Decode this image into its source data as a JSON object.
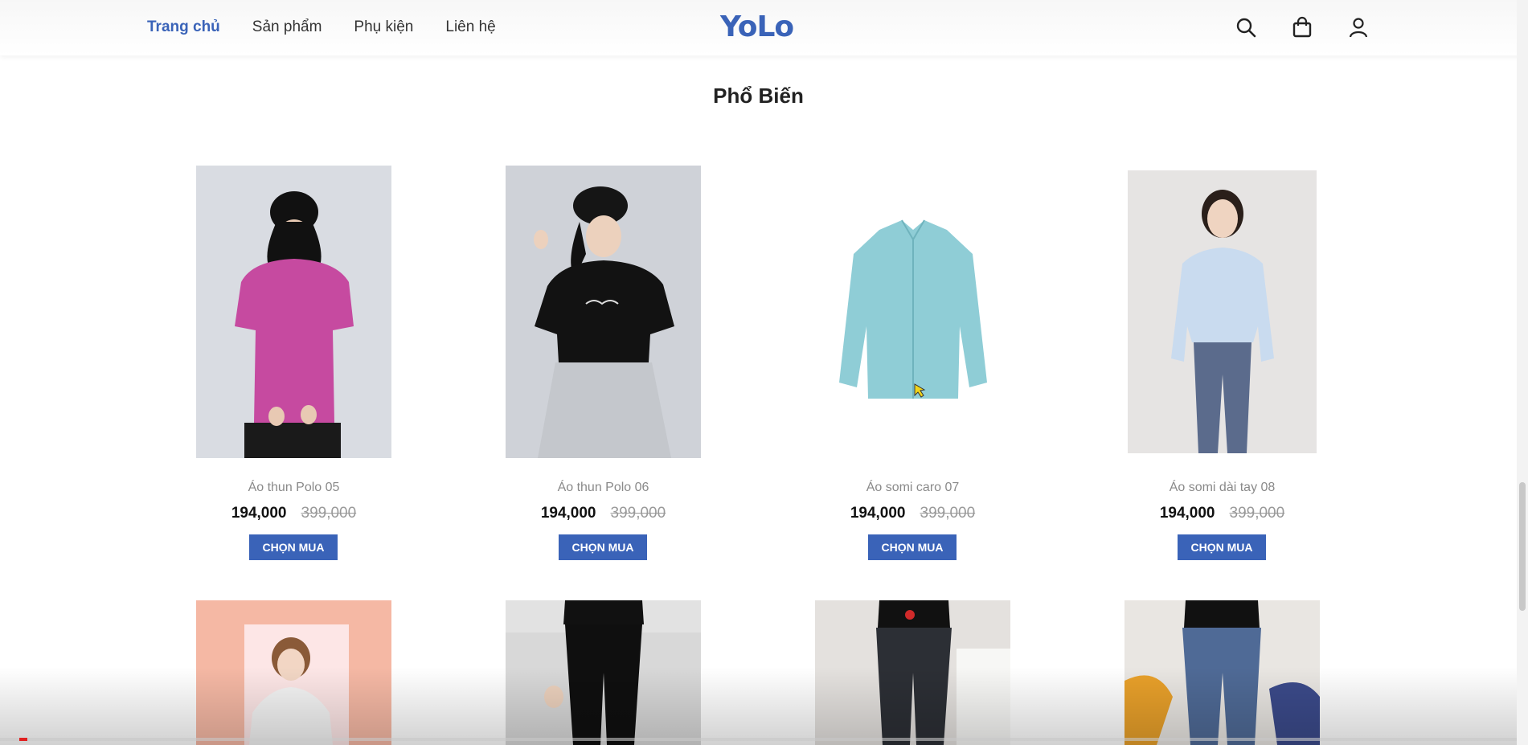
{
  "header": {
    "nav": [
      "Trang chủ",
      "Sản phẩm",
      "Phụ kiện",
      "Liên hệ"
    ],
    "logo": "YoLo",
    "icons": [
      "search-icon",
      "shopping-bag-icon",
      "user-icon"
    ],
    "accent_color": "#3a63b8"
  },
  "section": {
    "title": "Phổ Biến"
  },
  "products": [
    {
      "name": "Áo thun Polo 05",
      "price": "194,000",
      "old_price": "399,000",
      "button": "CHỌN MUA"
    },
    {
      "name": "Áo thun Polo 06",
      "price": "194,000",
      "old_price": "399,000",
      "button": "CHỌN MUA"
    },
    {
      "name": "Áo somi caro 07",
      "price": "194,000",
      "old_price": "399,000",
      "button": "CHỌN MUA"
    },
    {
      "name": "Áo somi dài tay 08",
      "price": "194,000",
      "old_price": "399,000",
      "button": "CHỌN MUA"
    }
  ]
}
